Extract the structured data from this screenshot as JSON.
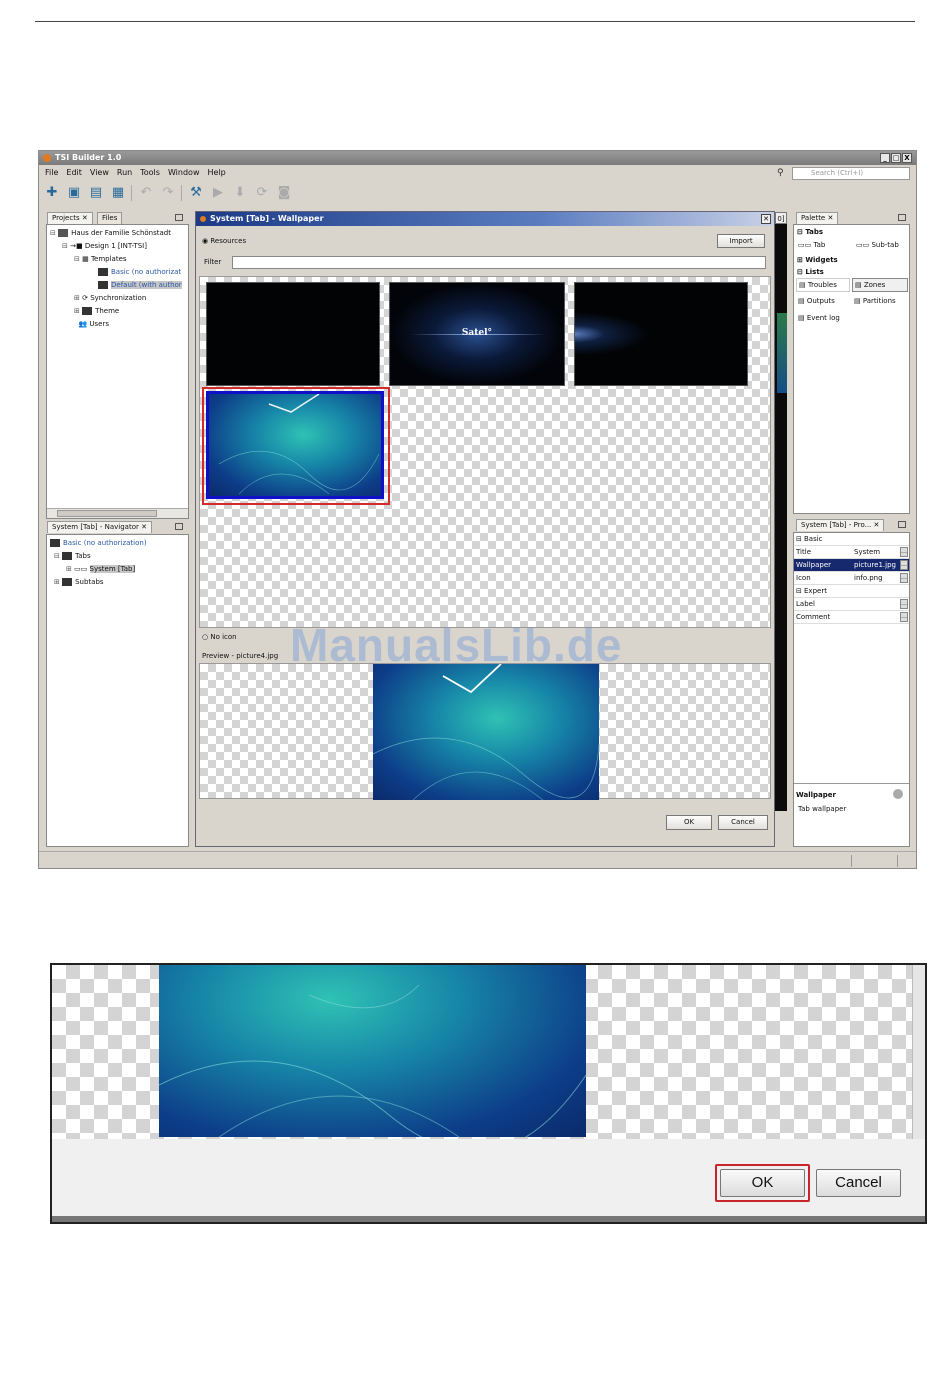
{
  "app": {
    "title": "TSI Builder 1.0",
    "window_buttons": [
      "_",
      "□",
      "X"
    ],
    "menu": [
      "File",
      "Edit",
      "View",
      "Run",
      "Tools",
      "Window",
      "Help"
    ],
    "search_placeholder": "Search (Ctrl+I)"
  },
  "projects_panel": {
    "tabs": [
      "Projects ✕",
      "Files"
    ],
    "tree": [
      {
        "label": "Haus der Familie Schönstadt",
        "level": 0
      },
      {
        "label": "Design 1 [INT-TSI]",
        "level": 1
      },
      {
        "label": "Templates",
        "level": 2
      },
      {
        "label": "Basic (no authorizat",
        "level": 3,
        "link": true
      },
      {
        "label": "Default (with author",
        "level": 3,
        "link": true,
        "selected": true
      },
      {
        "label": "Synchronization",
        "level": 2
      },
      {
        "label": "Theme",
        "level": 2
      },
      {
        "label": "Users",
        "level": 2
      }
    ]
  },
  "navigator_panel": {
    "tab": "System [Tab] - Navigator ✕",
    "tree": [
      {
        "label": "Basic (no authorization)",
        "level": 0,
        "link": true
      },
      {
        "label": "Tabs",
        "level": 1
      },
      {
        "label": "System [Tab]",
        "level": 2,
        "selected": true
      },
      {
        "label": "Subtabs",
        "level": 1
      }
    ]
  },
  "dialog": {
    "title": "System [Tab] - Wallpaper",
    "resources_label": "Resources",
    "import_button": "Import",
    "filter_label": "Filter",
    "filter_value": "",
    "thumb_text": "Satel°",
    "no_icon_label": "No icon",
    "preview_label": "Preview - picture4.jpg",
    "ok_button": "OK",
    "cancel_button": "Cancel"
  },
  "palette": {
    "tab": "Palette ✕",
    "sections": {
      "tabs": "Tabs",
      "widgets": "Widgets",
      "lists": "Lists"
    },
    "items": {
      "tab": "Tab",
      "subtab": "Sub-tab",
      "troubles": "Troubles",
      "zones": "Zones",
      "outputs": "Outputs",
      "partitions": "Partitions",
      "eventlog": "Event log"
    }
  },
  "properties": {
    "tab": "System [Tab] - Pro... ✕",
    "basic_label": "Basic",
    "expert_label": "Expert",
    "rows": [
      {
        "name": "Title",
        "value": "System"
      },
      {
        "name": "Wallpaper",
        "value": "picture1.jpg",
        "selected": true
      },
      {
        "name": "Icon",
        "value": "info.png"
      },
      {
        "name": "Label",
        "value": ""
      },
      {
        "name": "Comment",
        "value": ""
      }
    ],
    "help_title": "Wallpaper",
    "help_text": "Tab wallpaper"
  },
  "watermark": "ManualsLib.de",
  "zoom": {
    "ok_button": "OK",
    "cancel_button": "Cancel"
  }
}
